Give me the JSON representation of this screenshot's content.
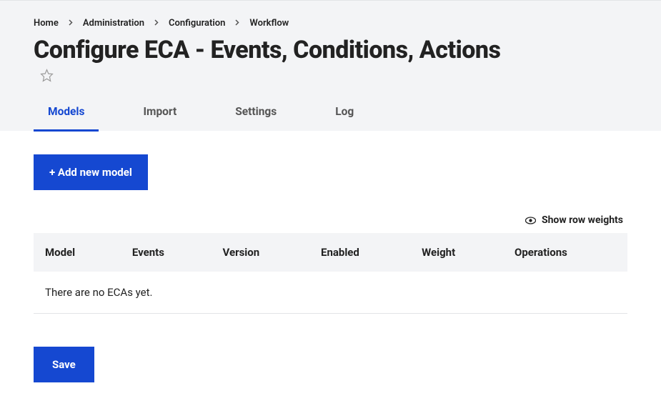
{
  "breadcrumb": {
    "items": [
      "Home",
      "Administration",
      "Configuration",
      "Workflow"
    ]
  },
  "page": {
    "title": "Configure ECA - Events, Conditions, Actions"
  },
  "tabs": {
    "items": [
      "Models",
      "Import",
      "Settings",
      "Log"
    ],
    "active": 0
  },
  "actions": {
    "add_model_label": "+ Add new model",
    "show_row_weights_label": "Show row weights",
    "save_label": "Save"
  },
  "table": {
    "headers": [
      "Model",
      "Events",
      "Version",
      "Enabled",
      "Weight",
      "Operations"
    ],
    "empty_message": "There are no ECAs yet."
  }
}
